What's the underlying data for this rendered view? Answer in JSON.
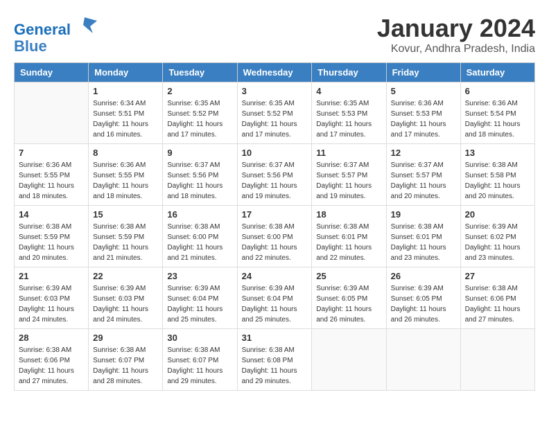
{
  "logo": {
    "line1": "General",
    "line2": "Blue"
  },
  "title": "January 2024",
  "location": "Kovur, Andhra Pradesh, India",
  "weekdays": [
    "Sunday",
    "Monday",
    "Tuesday",
    "Wednesday",
    "Thursday",
    "Friday",
    "Saturday"
  ],
  "weeks": [
    [
      {
        "day": "",
        "sunrise": "",
        "sunset": "",
        "daylight": ""
      },
      {
        "day": "1",
        "sunrise": "Sunrise: 6:34 AM",
        "sunset": "Sunset: 5:51 PM",
        "daylight": "Daylight: 11 hours and 16 minutes."
      },
      {
        "day": "2",
        "sunrise": "Sunrise: 6:35 AM",
        "sunset": "Sunset: 5:52 PM",
        "daylight": "Daylight: 11 hours and 17 minutes."
      },
      {
        "day": "3",
        "sunrise": "Sunrise: 6:35 AM",
        "sunset": "Sunset: 5:52 PM",
        "daylight": "Daylight: 11 hours and 17 minutes."
      },
      {
        "day": "4",
        "sunrise": "Sunrise: 6:35 AM",
        "sunset": "Sunset: 5:53 PM",
        "daylight": "Daylight: 11 hours and 17 minutes."
      },
      {
        "day": "5",
        "sunrise": "Sunrise: 6:36 AM",
        "sunset": "Sunset: 5:53 PM",
        "daylight": "Daylight: 11 hours and 17 minutes."
      },
      {
        "day": "6",
        "sunrise": "Sunrise: 6:36 AM",
        "sunset": "Sunset: 5:54 PM",
        "daylight": "Daylight: 11 hours and 18 minutes."
      }
    ],
    [
      {
        "day": "7",
        "sunrise": "Sunrise: 6:36 AM",
        "sunset": "Sunset: 5:55 PM",
        "daylight": "Daylight: 11 hours and 18 minutes."
      },
      {
        "day": "8",
        "sunrise": "Sunrise: 6:36 AM",
        "sunset": "Sunset: 5:55 PM",
        "daylight": "Daylight: 11 hours and 18 minutes."
      },
      {
        "day": "9",
        "sunrise": "Sunrise: 6:37 AM",
        "sunset": "Sunset: 5:56 PM",
        "daylight": "Daylight: 11 hours and 18 minutes."
      },
      {
        "day": "10",
        "sunrise": "Sunrise: 6:37 AM",
        "sunset": "Sunset: 5:56 PM",
        "daylight": "Daylight: 11 hours and 19 minutes."
      },
      {
        "day": "11",
        "sunrise": "Sunrise: 6:37 AM",
        "sunset": "Sunset: 5:57 PM",
        "daylight": "Daylight: 11 hours and 19 minutes."
      },
      {
        "day": "12",
        "sunrise": "Sunrise: 6:37 AM",
        "sunset": "Sunset: 5:57 PM",
        "daylight": "Daylight: 11 hours and 20 minutes."
      },
      {
        "day": "13",
        "sunrise": "Sunrise: 6:38 AM",
        "sunset": "Sunset: 5:58 PM",
        "daylight": "Daylight: 11 hours and 20 minutes."
      }
    ],
    [
      {
        "day": "14",
        "sunrise": "Sunrise: 6:38 AM",
        "sunset": "Sunset: 5:59 PM",
        "daylight": "Daylight: 11 hours and 20 minutes."
      },
      {
        "day": "15",
        "sunrise": "Sunrise: 6:38 AM",
        "sunset": "Sunset: 5:59 PM",
        "daylight": "Daylight: 11 hours and 21 minutes."
      },
      {
        "day": "16",
        "sunrise": "Sunrise: 6:38 AM",
        "sunset": "Sunset: 6:00 PM",
        "daylight": "Daylight: 11 hours and 21 minutes."
      },
      {
        "day": "17",
        "sunrise": "Sunrise: 6:38 AM",
        "sunset": "Sunset: 6:00 PM",
        "daylight": "Daylight: 11 hours and 22 minutes."
      },
      {
        "day": "18",
        "sunrise": "Sunrise: 6:38 AM",
        "sunset": "Sunset: 6:01 PM",
        "daylight": "Daylight: 11 hours and 22 minutes."
      },
      {
        "day": "19",
        "sunrise": "Sunrise: 6:38 AM",
        "sunset": "Sunset: 6:01 PM",
        "daylight": "Daylight: 11 hours and 23 minutes."
      },
      {
        "day": "20",
        "sunrise": "Sunrise: 6:39 AM",
        "sunset": "Sunset: 6:02 PM",
        "daylight": "Daylight: 11 hours and 23 minutes."
      }
    ],
    [
      {
        "day": "21",
        "sunrise": "Sunrise: 6:39 AM",
        "sunset": "Sunset: 6:03 PM",
        "daylight": "Daylight: 11 hours and 24 minutes."
      },
      {
        "day": "22",
        "sunrise": "Sunrise: 6:39 AM",
        "sunset": "Sunset: 6:03 PM",
        "daylight": "Daylight: 11 hours and 24 minutes."
      },
      {
        "day": "23",
        "sunrise": "Sunrise: 6:39 AM",
        "sunset": "Sunset: 6:04 PM",
        "daylight": "Daylight: 11 hours and 25 minutes."
      },
      {
        "day": "24",
        "sunrise": "Sunrise: 6:39 AM",
        "sunset": "Sunset: 6:04 PM",
        "daylight": "Daylight: 11 hours and 25 minutes."
      },
      {
        "day": "25",
        "sunrise": "Sunrise: 6:39 AM",
        "sunset": "Sunset: 6:05 PM",
        "daylight": "Daylight: 11 hours and 26 minutes."
      },
      {
        "day": "26",
        "sunrise": "Sunrise: 6:39 AM",
        "sunset": "Sunset: 6:05 PM",
        "daylight": "Daylight: 11 hours and 26 minutes."
      },
      {
        "day": "27",
        "sunrise": "Sunrise: 6:38 AM",
        "sunset": "Sunset: 6:06 PM",
        "daylight": "Daylight: 11 hours and 27 minutes."
      }
    ],
    [
      {
        "day": "28",
        "sunrise": "Sunrise: 6:38 AM",
        "sunset": "Sunset: 6:06 PM",
        "daylight": "Daylight: 11 hours and 27 minutes."
      },
      {
        "day": "29",
        "sunrise": "Sunrise: 6:38 AM",
        "sunset": "Sunset: 6:07 PM",
        "daylight": "Daylight: 11 hours and 28 minutes."
      },
      {
        "day": "30",
        "sunrise": "Sunrise: 6:38 AM",
        "sunset": "Sunset: 6:07 PM",
        "daylight": "Daylight: 11 hours and 29 minutes."
      },
      {
        "day": "31",
        "sunrise": "Sunrise: 6:38 AM",
        "sunset": "Sunset: 6:08 PM",
        "daylight": "Daylight: 11 hours and 29 minutes."
      },
      {
        "day": "",
        "sunrise": "",
        "sunset": "",
        "daylight": ""
      },
      {
        "day": "",
        "sunrise": "",
        "sunset": "",
        "daylight": ""
      },
      {
        "day": "",
        "sunrise": "",
        "sunset": "",
        "daylight": ""
      }
    ]
  ]
}
